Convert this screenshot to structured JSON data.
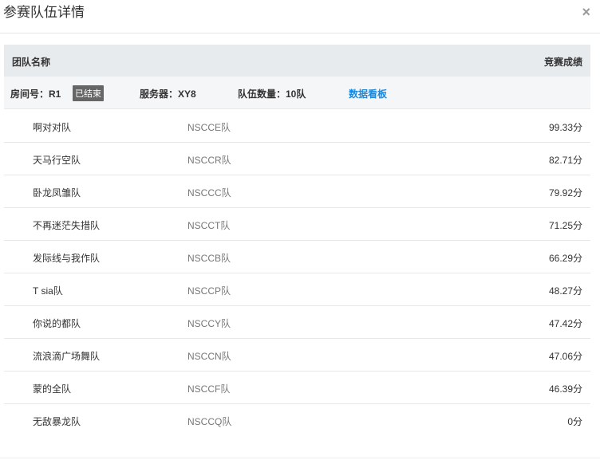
{
  "dialog": {
    "title": "参赛队伍详情",
    "close_label": "×"
  },
  "table": {
    "header_name": "团队名称",
    "header_score": "竞赛成绩"
  },
  "room": {
    "room_label": "房间号：R1",
    "status": "已结束",
    "server_label": "服务器：XY8",
    "team_count_label": "队伍数量：10队",
    "dashboard_link": "数据看板"
  },
  "teams": [
    {
      "name": "啊对对队",
      "code": "NSCCE队",
      "score": "99.33分"
    },
    {
      "name": "天马行空队",
      "code": "NSCCR队",
      "score": "82.71分"
    },
    {
      "name": "卧龙凤雏队",
      "code": "NSCCC队",
      "score": "79.92分"
    },
    {
      "name": "不再迷茫失措队",
      "code": "NSCCT队",
      "score": "71.25分"
    },
    {
      "name": "发际线与我作队",
      "code": "NSCCB队",
      "score": "66.29分"
    },
    {
      "name": "T sia队",
      "code": "NSCCP队",
      "score": "48.27分"
    },
    {
      "name": "你说的都队",
      "code": "NSCCY队",
      "score": "47.42分"
    },
    {
      "name": "流浪滴广场舞队",
      "code": "NSCCN队",
      "score": "47.06分"
    },
    {
      "name": "蒙的全队",
      "code": "NSCCF队",
      "score": "46.39分"
    },
    {
      "name": "无敌暴龙队",
      "code": "NSCCQ队",
      "score": "0分"
    }
  ]
}
